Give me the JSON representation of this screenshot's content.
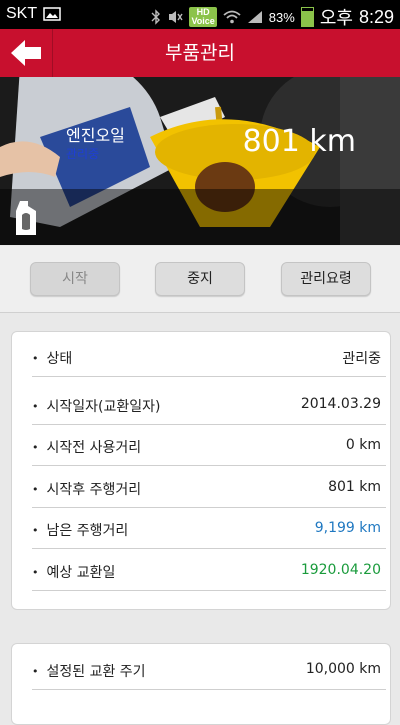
{
  "status_bar": {
    "carrier": "SKT",
    "hd_label": "HD",
    "voice_label": "Voice",
    "battery": "83%",
    "ampm": "오후",
    "time": "8:29"
  },
  "header": {
    "title": "부품관리"
  },
  "hero": {
    "part_name": "엔진오일",
    "part_status": "관리중",
    "distance": "801 km"
  },
  "actions": {
    "start_label": "시작",
    "stop_label": "중지",
    "guide_label": "관리요령"
  },
  "details": [
    {
      "label": "상태",
      "value": "관리중"
    },
    {
      "label": "시작일자(교환일자)",
      "value": "2014.03.29"
    },
    {
      "label": "시작전 사용거리",
      "value": "0 km"
    },
    {
      "label": "시작후 주행거리",
      "value": "801 km"
    },
    {
      "label": "남은 주행거리",
      "value": "9,199 km"
    },
    {
      "label": "예상 교환일",
      "value": "1920.04.20"
    }
  ],
  "settings": [
    {
      "label": "설정된 교환 주기",
      "value": "10,000 km"
    }
  ],
  "colors": {
    "header": "#c8102e",
    "remaining": "#1f78c1",
    "date": "#1a9b3c"
  }
}
